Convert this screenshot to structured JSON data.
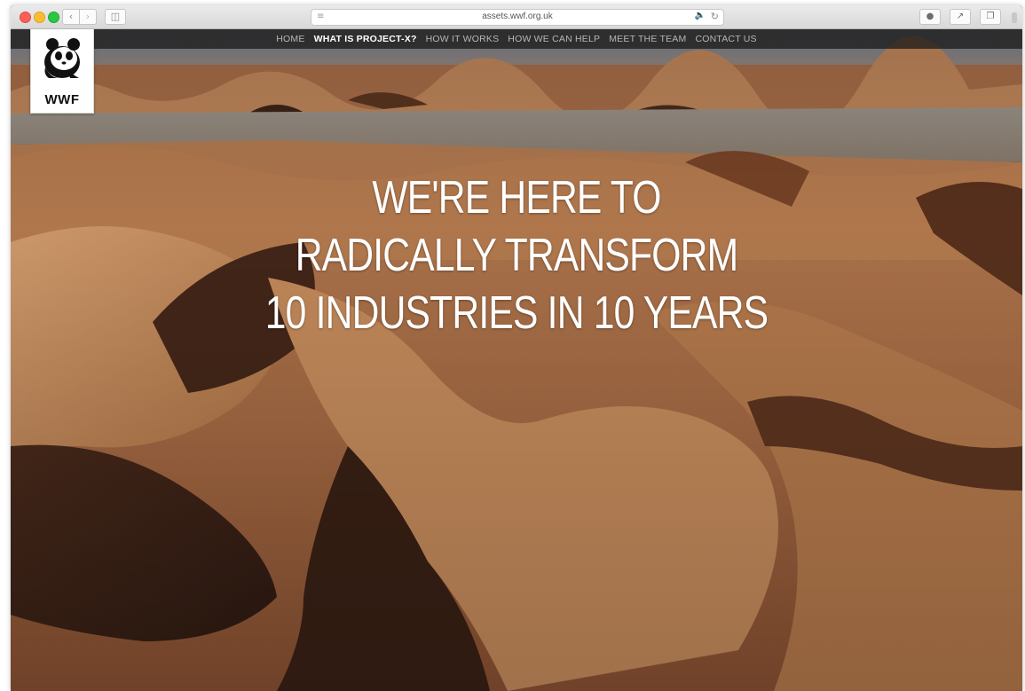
{
  "browser": {
    "url": "assets.wwf.org.uk",
    "icons": {
      "back": "chevron-left-icon",
      "forward": "chevron-right-icon",
      "sidebar": "sidebar-icon",
      "reader": "reader-icon",
      "audio": "speaker-icon",
      "reload": "reload-icon",
      "extension": "extension-icon",
      "share": "share-icon",
      "tabs": "tabs-icon"
    }
  },
  "site": {
    "logo_text": "WWF",
    "nav": [
      {
        "label": "HOME",
        "active": false
      },
      {
        "label": "WHAT IS PROJECT-X?",
        "active": true
      },
      {
        "label": "HOW IT WORKS",
        "active": false
      },
      {
        "label": "HOW WE CAN HELP",
        "active": false
      },
      {
        "label": "MEET THE TEAM",
        "active": false
      },
      {
        "label": "CONTACT US",
        "active": false
      }
    ],
    "headline": [
      "WE'RE HERE TO",
      "RADICALLY TRANSFORM",
      "10 INDUSTRIES IN 10 YEARS"
    ]
  },
  "colors": {
    "nav_active": "#ffffff",
    "nav_inactive": "#b9b6b3",
    "sand_light": "#c98d5c",
    "sand_dark": "#5a2e16"
  }
}
